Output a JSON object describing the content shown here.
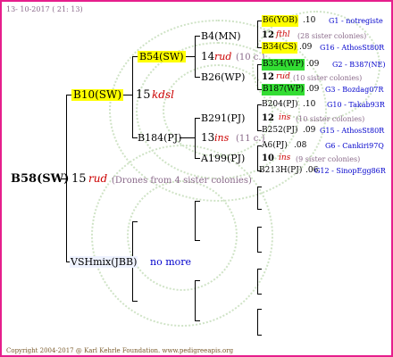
{
  "date": "13- 10-2017 ( 21: 13)",
  "footer": "Copyright 2004-2017 @ Karl Kehrle Foundation.   www.pedigreeapis.org",
  "colors": {
    "frame": "#e61e8c",
    "highlight": "#ffff00",
    "green": "#33dd33",
    "red": "#cc0000",
    "blue": "#0000cc",
    "gray": "#8a6a8a"
  },
  "root": {
    "name": "B58(SW)",
    "gen": "15",
    "code": "rud",
    "note": "(Drones from 4 sister colonies)"
  },
  "father": {
    "name": "B10(SW)",
    "gen": "15",
    "code": "kdsl"
  },
  "mother": {
    "name": "VSHmix(JBB)",
    "note": "no more"
  },
  "g2": [
    {
      "name": "B54(SW)",
      "gen": "14",
      "code": "rud",
      "note": "(10 c.)"
    },
    {
      "name": "B184(PJ)",
      "gen": "13",
      "code": "ins",
      "note": "(11 c.)"
    }
  ],
  "g3": [
    "B4(MN)",
    "B26(WP)",
    "B291(PJ)",
    "A199(PJ)"
  ],
  "g4": [
    {
      "name": "B6(YOB)",
      "num": ".10",
      "right": "G1 - notregiste"
    },
    {
      "gen": "12",
      "code": "fthl",
      "note": "(28 sister colonies)"
    },
    {
      "name": "B34(CS)",
      "num": ".09",
      "right": "G16 - AthosSt80R"
    },
    {
      "name": "B334(WP)",
      "num": ".09",
      "right": "G2 - B387(NE)"
    },
    {
      "gen": "12",
      "code": "rud",
      "note": "(10 sister colonies)"
    },
    {
      "name": "B187(WP)",
      "num": ".09",
      "right": "G3 - Bozdag07R"
    },
    {
      "name": "B204(PJ)",
      "num": ".10",
      "right": "G10 - Takab93R"
    },
    {
      "gen": "12",
      "code": "ins",
      "note": "(10 sister colonies)"
    },
    {
      "name": "B252(PJ)",
      "num": ".09",
      "right": "G15 - AthosSt80R"
    },
    {
      "name": "A6(PJ)",
      "num": ".08",
      "right": "G6 - Cankiri97Q"
    },
    {
      "gen": "10",
      "code": "ins",
      "note": "(9 sister colonies)"
    },
    {
      "name": "B213H(PJ)",
      "num": ".06",
      "right": "G12 - SinopEgg86R"
    }
  ]
}
